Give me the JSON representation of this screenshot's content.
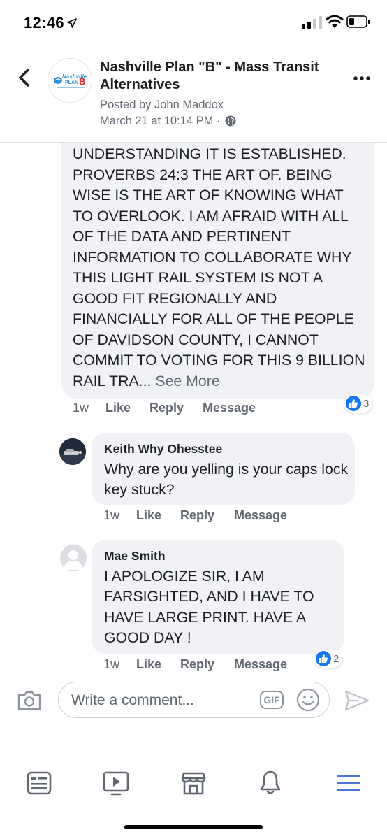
{
  "status_bar": {
    "time": "12:46"
  },
  "header": {
    "page_name": "Nashville Plan \"B\" - Mass Transit Alternatives",
    "posted_by": "Posted by John Maddox",
    "date": "March 21 at 10:14 PM ·",
    "logo_text": "Nashville PLAN B"
  },
  "comments": [
    {
      "text": "UNDERSTANDING IT IS ESTABLISHED. PROVERBS  24:3  THE ART OF. BEING WISE IS THE ART OF KNOWING WHAT TO OVERLOOK.  I AM AFRAID WITH ALL OF THE DATA AND PERTINENT INFORMATION TO COLLABORATE WHY THIS LIGHT RAIL  SYSTEM IS NOT A GOOD  FIT REGIONALLY AND FINANCIALLY  FOR ALL OF THE PEOPLE OF DAVIDSON  COUNTY, I CANNOT COMMIT TO VOTING FOR THIS 9 BILLION RAIL TRA...",
      "see_more": "See More",
      "time": "1w",
      "like": "Like",
      "reply": "Reply",
      "message": "Message",
      "reactions": "3"
    },
    {
      "author": "Keith Why Ohesstee",
      "text": "Why are you yelling is your caps lock key stuck?",
      "time": "1w",
      "like": "Like",
      "reply": "Reply",
      "message": "Message"
    },
    {
      "author": "Mae Smith",
      "text": "I APOLOGIZE  SIR, I AM FARSIGHTED,  AND I HAVE TO HAVE LARGE PRINT. HAVE  A GOOD DAY !",
      "time": "1w",
      "like": "Like",
      "reply": "Reply",
      "message": "Message",
      "reactions": "2"
    }
  ],
  "composer": {
    "placeholder": "Write a comment...",
    "gif_label": "GIF"
  },
  "colors": {
    "accent": "#1877f2",
    "bubble": "#f0f2f5",
    "secondary_text": "#606770"
  },
  "bottom_nav": [
    "news-feed-icon",
    "watch-icon",
    "marketplace-icon",
    "notifications-icon",
    "menu-icon"
  ]
}
